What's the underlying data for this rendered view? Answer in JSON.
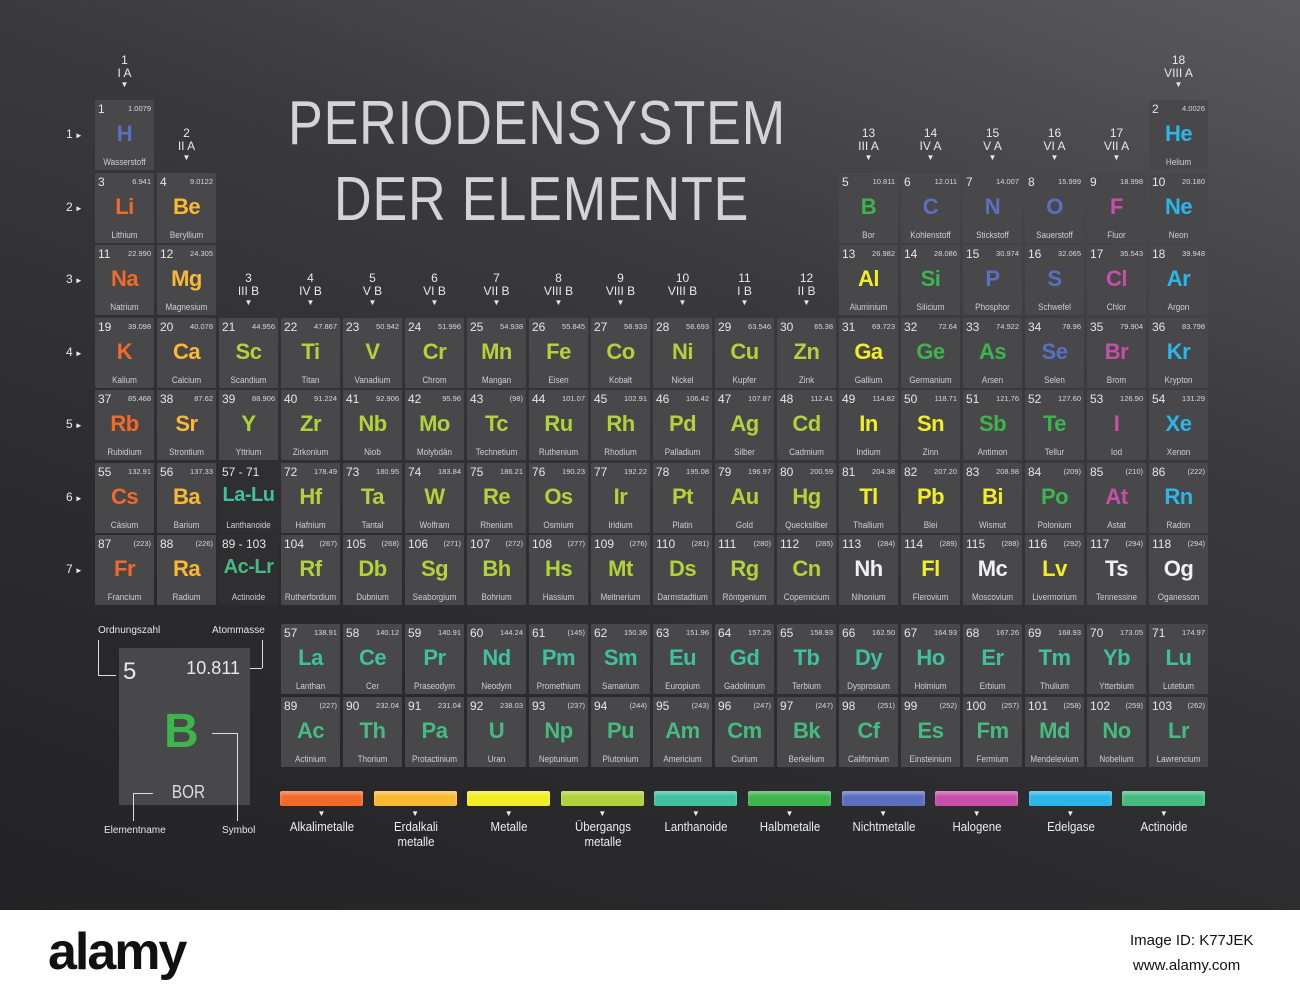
{
  "title": {
    "line1": "PERIODENSYSTEM",
    "line2": "DER ELEMENTE"
  },
  "colors": {
    "a": "#f26a2a",
    "e": "#fbb933",
    "m": "#f2ee25",
    "t": "#b2d13a",
    "l": "#3fc0a0",
    "h": "#3db54c",
    "n": "#5b6fc0",
    "g": "#c64fa8",
    "x": "#2cb6e8",
    "c": "#46bb80",
    "u": "#f0f0f0"
  },
  "groups": [
    {
      "n": "1",
      "r": "I A"
    },
    {
      "n": "2",
      "r": "II A"
    },
    {
      "n": "3",
      "r": "III B"
    },
    {
      "n": "4",
      "r": "IV B"
    },
    {
      "n": "5",
      "r": "V B"
    },
    {
      "n": "6",
      "r": "VI B"
    },
    {
      "n": "7",
      "r": "VII B"
    },
    {
      "n": "8",
      "r": "VIII B"
    },
    {
      "n": "9",
      "r": "VIII B"
    },
    {
      "n": "10",
      "r": "VIII B"
    },
    {
      "n": "11",
      "r": "I B"
    },
    {
      "n": "12",
      "r": "II B"
    },
    {
      "n": "13",
      "r": "III A"
    },
    {
      "n": "14",
      "r": "IV A"
    },
    {
      "n": "15",
      "r": "V A"
    },
    {
      "n": "16",
      "r": "VI A"
    },
    {
      "n": "17",
      "r": "VII A"
    },
    {
      "n": "18",
      "r": "VIII A"
    }
  ],
  "periods": [
    "1",
    "2",
    "3",
    "4",
    "5",
    "6",
    "7"
  ],
  "elements": [
    [
      "1",
      "H",
      "1.0079",
      "Wasserstoff",
      "n",
      1,
      1
    ],
    [
      "2",
      "He",
      "4.0026",
      "Helium",
      "x",
      1,
      18
    ],
    [
      "3",
      "Li",
      "6.941",
      "Lithium",
      "a",
      2,
      1
    ],
    [
      "4",
      "Be",
      "9.0122",
      "Beryllium",
      "e",
      2,
      2
    ],
    [
      "5",
      "B",
      "10.811",
      "Bor",
      "h",
      2,
      13
    ],
    [
      "6",
      "C",
      "12.011",
      "Kohlenstoff",
      "n",
      2,
      14
    ],
    [
      "7",
      "N",
      "14.007",
      "Stickstoff",
      "n",
      2,
      15
    ],
    [
      "8",
      "O",
      "15.999",
      "Sauerstoff",
      "n",
      2,
      16
    ],
    [
      "9",
      "F",
      "18.998",
      "Fluor",
      "g",
      2,
      17
    ],
    [
      "10",
      "Ne",
      "20.180",
      "Neon",
      "x",
      2,
      18
    ],
    [
      "11",
      "Na",
      "22.990",
      "Natrium",
      "a",
      3,
      1
    ],
    [
      "12",
      "Mg",
      "24.305",
      "Magnesium",
      "e",
      3,
      2
    ],
    [
      "13",
      "Al",
      "26.982",
      "Aluminium",
      "m",
      3,
      13
    ],
    [
      "14",
      "Si",
      "28.086",
      "Silicium",
      "h",
      3,
      14
    ],
    [
      "15",
      "P",
      "30.974",
      "Phosphor",
      "n",
      3,
      15
    ],
    [
      "16",
      "S",
      "32.065",
      "Schwefel",
      "n",
      3,
      16
    ],
    [
      "17",
      "Cl",
      "35.543",
      "Chlor",
      "g",
      3,
      17
    ],
    [
      "18",
      "Ar",
      "39.948",
      "Argon",
      "x",
      3,
      18
    ],
    [
      "19",
      "K",
      "39.098",
      "Kalium",
      "a",
      4,
      1
    ],
    [
      "20",
      "Ca",
      "40.078",
      "Calcium",
      "e",
      4,
      2
    ],
    [
      "21",
      "Sc",
      "44.956",
      "Scandium",
      "t",
      4,
      3
    ],
    [
      "22",
      "Ti",
      "47.867",
      "Titan",
      "t",
      4,
      4
    ],
    [
      "23",
      "V",
      "50.942",
      "Vanadium",
      "t",
      4,
      5
    ],
    [
      "24",
      "Cr",
      "51.996",
      "Chrom",
      "t",
      4,
      6
    ],
    [
      "25",
      "Mn",
      "54.938",
      "Mangan",
      "t",
      4,
      7
    ],
    [
      "26",
      "Fe",
      "55.845",
      "Eisen",
      "t",
      4,
      8
    ],
    [
      "27",
      "Co",
      "58.933",
      "Kobalt",
      "t",
      4,
      9
    ],
    [
      "28",
      "Ni",
      "58.693",
      "Nickel",
      "t",
      4,
      10
    ],
    [
      "29",
      "Cu",
      "63.546",
      "Kupfer",
      "t",
      4,
      11
    ],
    [
      "30",
      "Zn",
      "65.38",
      "Zink",
      "t",
      4,
      12
    ],
    [
      "31",
      "Ga",
      "69.723",
      "Gallium",
      "m",
      4,
      13
    ],
    [
      "32",
      "Ge",
      "72.64",
      "Germanium",
      "h",
      4,
      14
    ],
    [
      "33",
      "As",
      "74.922",
      "Arsen",
      "h",
      4,
      15
    ],
    [
      "34",
      "Se",
      "78.96",
      "Selen",
      "n",
      4,
      16
    ],
    [
      "35",
      "Br",
      "79.904",
      "Brom",
      "g",
      4,
      17
    ],
    [
      "36",
      "Kr",
      "83.798",
      "Krypton",
      "x",
      4,
      18
    ],
    [
      "37",
      "Rb",
      "85.468",
      "Rubidium",
      "a",
      5,
      1
    ],
    [
      "38",
      "Sr",
      "87.62",
      "Strontium",
      "e",
      5,
      2
    ],
    [
      "39",
      "Y",
      "88.906",
      "Yttrium",
      "t",
      5,
      3
    ],
    [
      "40",
      "Zr",
      "91.224",
      "Zirkonium",
      "t",
      5,
      4
    ],
    [
      "41",
      "Nb",
      "92.906",
      "Niob",
      "t",
      5,
      5
    ],
    [
      "42",
      "Mo",
      "95.96",
      "Molybdän",
      "t",
      5,
      6
    ],
    [
      "43",
      "Tc",
      "(98)",
      "Technetium",
      "t",
      5,
      7
    ],
    [
      "44",
      "Ru",
      "101.07",
      "Ruthenium",
      "t",
      5,
      8
    ],
    [
      "45",
      "Rh",
      "102.91",
      "Rhodium",
      "t",
      5,
      9
    ],
    [
      "46",
      "Pd",
      "106.42",
      "Palladium",
      "t",
      5,
      10
    ],
    [
      "47",
      "Ag",
      "107.87",
      "Silber",
      "t",
      5,
      11
    ],
    [
      "48",
      "Cd",
      "112.41",
      "Cadmium",
      "t",
      5,
      12
    ],
    [
      "49",
      "In",
      "114.82",
      "Indium",
      "m",
      5,
      13
    ],
    [
      "50",
      "Sn",
      "118.71",
      "Zinn",
      "m",
      5,
      14
    ],
    [
      "51",
      "Sb",
      "121.76",
      "Antimon",
      "h",
      5,
      15
    ],
    [
      "52",
      "Te",
      "127.60",
      "Tellur",
      "h",
      5,
      16
    ],
    [
      "53",
      "I",
      "126.90",
      "Iod",
      "g",
      5,
      17
    ],
    [
      "54",
      "Xe",
      "131.29",
      "Xenon",
      "x",
      5,
      18
    ],
    [
      "55",
      "Cs",
      "132.91",
      "Cäsium",
      "a",
      6,
      1
    ],
    [
      "56",
      "Ba",
      "137.33",
      "Barium",
      "e",
      6,
      2
    ],
    [
      "57 - 71",
      "La-Lu",
      "",
      "Lanthanoide",
      "l",
      6,
      3
    ],
    [
      "72",
      "Hf",
      "178.49",
      "Hafnium",
      "t",
      6,
      4
    ],
    [
      "73",
      "Ta",
      "180.95",
      "Tantal",
      "t",
      6,
      5
    ],
    [
      "74",
      "W",
      "183.84",
      "Wolfram",
      "t",
      6,
      6
    ],
    [
      "75",
      "Re",
      "186.21",
      "Rhenium",
      "t",
      6,
      7
    ],
    [
      "76",
      "Os",
      "190.23",
      "Osmium",
      "t",
      6,
      8
    ],
    [
      "77",
      "Ir",
      "192.22",
      "Iridium",
      "t",
      6,
      9
    ],
    [
      "78",
      "Pt",
      "195.08",
      "Platin",
      "t",
      6,
      10
    ],
    [
      "79",
      "Au",
      "196.97",
      "Gold",
      "t",
      6,
      11
    ],
    [
      "80",
      "Hg",
      "200.59",
      "Quecksilber",
      "t",
      6,
      12
    ],
    [
      "81",
      "Tl",
      "204.38",
      "Thallium",
      "m",
      6,
      13
    ],
    [
      "82",
      "Pb",
      "207.20",
      "Blei",
      "m",
      6,
      14
    ],
    [
      "83",
      "Bi",
      "208.98",
      "Wismut",
      "m",
      6,
      15
    ],
    [
      "84",
      "Po",
      "(209)",
      "Polonium",
      "h",
      6,
      16
    ],
    [
      "85",
      "At",
      "(210)",
      "Astat",
      "g",
      6,
      17
    ],
    [
      "86",
      "Rn",
      "(222)",
      "Radon",
      "x",
      6,
      18
    ],
    [
      "87",
      "Fr",
      "(223)",
      "Francium",
      "a",
      7,
      1
    ],
    [
      "88",
      "Ra",
      "(226)",
      "Radium",
      "e",
      7,
      2
    ],
    [
      "89 - 103",
      "Ac-Lr",
      "",
      "Actinoide",
      "c",
      7,
      3
    ],
    [
      "104",
      "Rf",
      "(267)",
      "Rutherfordium",
      "t",
      7,
      4
    ],
    [
      "105",
      "Db",
      "(268)",
      "Dubnium",
      "t",
      7,
      5
    ],
    [
      "106",
      "Sg",
      "(271)",
      "Seaborgium",
      "t",
      7,
      6
    ],
    [
      "107",
      "Bh",
      "(272)",
      "Bohrium",
      "t",
      7,
      7
    ],
    [
      "108",
      "Hs",
      "(277)",
      "Hassium",
      "t",
      7,
      8
    ],
    [
      "109",
      "Mt",
      "(276)",
      "Meitnerium",
      "t",
      7,
      9
    ],
    [
      "110",
      "Ds",
      "(281)",
      "Darmstadtium",
      "t",
      7,
      10
    ],
    [
      "111",
      "Rg",
      "(280)",
      "Röntgenium",
      "t",
      7,
      11
    ],
    [
      "112",
      "Cn",
      "(285)",
      "Copernicium",
      "t",
      7,
      12
    ],
    [
      "113",
      "Nh",
      "(284)",
      "Nihonium",
      "u",
      7,
      13
    ],
    [
      "114",
      "Fl",
      "(289)",
      "Flerovium",
      "m",
      7,
      14
    ],
    [
      "115",
      "Mc",
      "(288)",
      "Moscovium",
      "u",
      7,
      15
    ],
    [
      "116",
      "Lv",
      "(292)",
      "Livermorium",
      "m",
      7,
      16
    ],
    [
      "117",
      "Ts",
      "(294)",
      "Tennessine",
      "u",
      7,
      17
    ],
    [
      "118",
      "Og",
      "(294)",
      "Oganesson",
      "u",
      7,
      18
    ]
  ],
  "lanthanoids": [
    [
      "57",
      "La",
      "138.91",
      "Lanthan"
    ],
    [
      "58",
      "Ce",
      "140.12",
      "Cer"
    ],
    [
      "59",
      "Pr",
      "140.91",
      "Praseodym"
    ],
    [
      "60",
      "Nd",
      "144.24",
      "Neodym"
    ],
    [
      "61",
      "Pm",
      "(145)",
      "Promethium"
    ],
    [
      "62",
      "Sm",
      "150.36",
      "Samarium"
    ],
    [
      "63",
      "Eu",
      "151.96",
      "Europium"
    ],
    [
      "64",
      "Gd",
      "157.25",
      "Gadolinium"
    ],
    [
      "65",
      "Tb",
      "158.93",
      "Terbium"
    ],
    [
      "66",
      "Dy",
      "162.50",
      "Dysprosium"
    ],
    [
      "67",
      "Ho",
      "164.93",
      "Holmium"
    ],
    [
      "68",
      "Er",
      "167.26",
      "Erbium"
    ],
    [
      "69",
      "Tm",
      "168.93",
      "Thulium"
    ],
    [
      "70",
      "Yb",
      "173.05",
      "Ytterbium"
    ],
    [
      "71",
      "Lu",
      "174.97",
      "Lutetium"
    ]
  ],
  "actinoids": [
    [
      "89",
      "Ac",
      "(227)",
      "Actinium"
    ],
    [
      "90",
      "Th",
      "232.04",
      "Thorium"
    ],
    [
      "91",
      "Pa",
      "231.04",
      "Protactinium"
    ],
    [
      "92",
      "U",
      "238.03",
      "Uran"
    ],
    [
      "93",
      "Np",
      "(237)",
      "Neptunium"
    ],
    [
      "94",
      "Pu",
      "(244)",
      "Plutonium"
    ],
    [
      "95",
      "Am",
      "(243)",
      "Americium"
    ],
    [
      "96",
      "Cm",
      "(247)",
      "Curium"
    ],
    [
      "97",
      "Bk",
      "(247)",
      "Berkelium"
    ],
    [
      "98",
      "Cf",
      "(251)",
      "Californium"
    ],
    [
      "99",
      "Es",
      "(252)",
      "Einsteinium"
    ],
    [
      "100",
      "Fm",
      "(257)",
      "Fermium"
    ],
    [
      "101",
      "Md",
      "(258)",
      "Mendelevium"
    ],
    [
      "102",
      "No",
      "(259)",
      "Nobelium"
    ],
    [
      "103",
      "Lr",
      "(262)",
      "Lawrencium"
    ]
  ],
  "key": {
    "number": "5",
    "mass": "10.811",
    "symbol": "B",
    "name": "BOR",
    "label_number": "Ordnungszahl",
    "label_mass": "Atommasse",
    "label_name": "Elementname",
    "label_symbol": "Symbol"
  },
  "legend": [
    {
      "label": "Alkalimetalle",
      "cat": "a"
    },
    {
      "label": "Erdalkali metalle",
      "cat": "e"
    },
    {
      "label": "Metalle",
      "cat": "m"
    },
    {
      "label": "Übergangs metalle",
      "cat": "t"
    },
    {
      "label": "Lanthanoide",
      "cat": "l"
    },
    {
      "label": "Halbmetalle",
      "cat": "h"
    },
    {
      "label": "Nichtmetalle",
      "cat": "n"
    },
    {
      "label": "Halogene",
      "cat": "g"
    },
    {
      "label": "Edelgase",
      "cat": "x"
    },
    {
      "label": "Actinoide",
      "cat": "c"
    }
  ],
  "footer": {
    "logo": "alamy",
    "image_id": "Image ID: K77JEK",
    "url": "www.alamy.com"
  }
}
